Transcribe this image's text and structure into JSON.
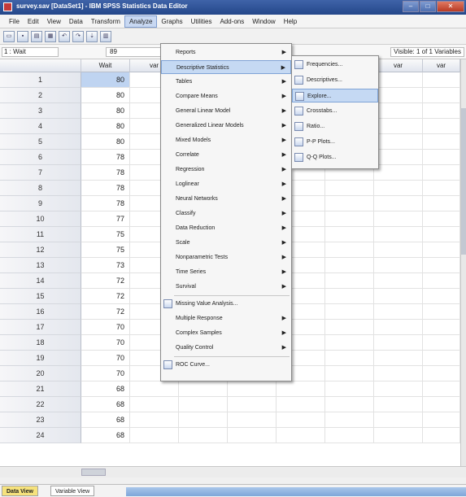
{
  "window": {
    "title": "survey.sav [DataSet1] - IBM SPSS Statistics Data Editor"
  },
  "menubar": [
    "File",
    "Edit",
    "View",
    "Data",
    "Transform",
    "Analyze",
    "Graphs",
    "Utilities",
    "Add-ons",
    "Window",
    "Help"
  ],
  "cellbar": {
    "cell_ref": "1 : Wait",
    "cell_value": "89",
    "visible": "Visible: 1 of 1 Variables"
  },
  "grid": {
    "column_header": "Wait",
    "rows": [
      "1",
      "2",
      "3",
      "4",
      "5",
      "6",
      "7",
      "8",
      "9",
      "10",
      "11",
      "12",
      "13",
      "14",
      "15",
      "16",
      "17",
      "18",
      "19",
      "20",
      "21",
      "22",
      "23",
      "24"
    ],
    "values": [
      "80",
      "80",
      "80",
      "80",
      "80",
      "78",
      "78",
      "78",
      "78",
      "77",
      "75",
      "75",
      "73",
      "72",
      "72",
      "72",
      "70",
      "70",
      "70",
      "70",
      "68",
      "68",
      "68",
      "68"
    ]
  },
  "analyze_menu": {
    "items": [
      {
        "label": "Reports",
        "submenu": true
      },
      {
        "label": "Descriptive Statistics",
        "submenu": true
      },
      {
        "label": "Tables",
        "submenu": true
      },
      {
        "label": "Compare Means",
        "submenu": true
      },
      {
        "label": "General Linear Model",
        "submenu": true
      },
      {
        "label": "Generalized Linear Models",
        "submenu": true
      },
      {
        "label": "Mixed Models",
        "submenu": true
      },
      {
        "label": "Correlate",
        "submenu": true
      },
      {
        "label": "Regression",
        "submenu": true
      },
      {
        "label": "Loglinear",
        "submenu": true
      },
      {
        "label": "Neural Networks",
        "submenu": true
      },
      {
        "label": "Classify",
        "submenu": true
      },
      {
        "label": "Data Reduction",
        "submenu": true
      },
      {
        "label": "Scale",
        "submenu": true
      },
      {
        "label": "Nonparametric Tests",
        "submenu": true
      },
      {
        "label": "Time Series",
        "submenu": true
      },
      {
        "label": "Survival",
        "submenu": true
      },
      {
        "label": "Missing Value Analysis...",
        "submenu": false
      },
      {
        "label": "Multiple Response",
        "submenu": true
      },
      {
        "label": "Complex Samples",
        "submenu": true
      },
      {
        "label": "Quality Control",
        "submenu": true
      },
      {
        "label": "ROC Curve...",
        "submenu": false
      }
    ]
  },
  "descriptives_submenu": {
    "items": [
      "Frequencies...",
      "Descriptives...",
      "Explore...",
      "Crosstabs...",
      "Ratio...",
      "P-P Plots...",
      "Q-Q Plots..."
    ]
  },
  "tabs": {
    "data_view": "Data View",
    "variable_view": "Variable View"
  }
}
